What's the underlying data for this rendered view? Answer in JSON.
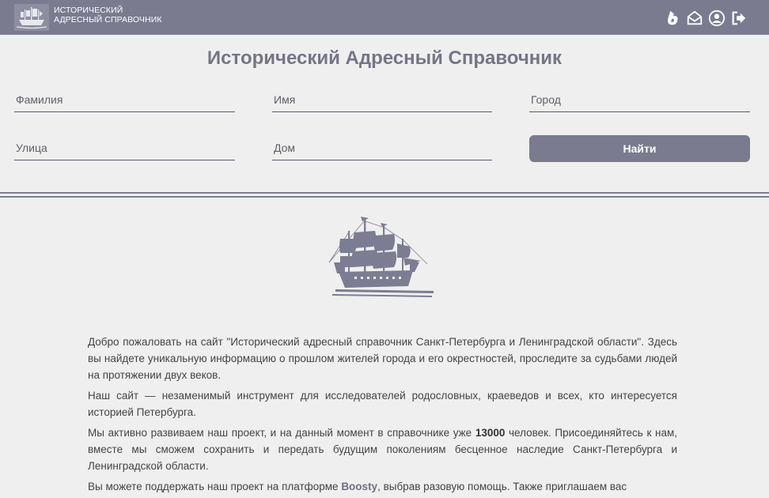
{
  "header": {
    "brand_line1": "ИСТОРИЧЕСКИЙ",
    "brand_line2": "АДРЕСНЫЙ СПРАВОЧНИК",
    "icons": [
      "boosty-icon",
      "mail-icon",
      "user-icon",
      "logout-icon"
    ]
  },
  "page_title": "Исторический Адресный Справочник",
  "search": {
    "surname_placeholder": "Фамилия",
    "name_placeholder": "Имя",
    "city_placeholder": "Город",
    "street_placeholder": "Улица",
    "house_placeholder": "Дом",
    "button_label": "Найти"
  },
  "content": {
    "p1": "Добро пожаловать на сайт \"Исторический адресный справочник Санкт-Петербурга и Ленинградской области\". Здесь вы найдете уникальную информацию о прошлом жителей города и его окрестностей, проследите за судьбами людей на протяжении двух веков.",
    "p2": "Наш сайт — незаменимый инструмент для исследователей родословных, краеведов и всех, кто интересуется историей Петербурга.",
    "p3_a": "Мы активно развиваем наш проект, и на данный момент в справочнике уже ",
    "p3_count": "13000",
    "p3_b": " человек. Присоединяйтесь к нам, вместе мы сможем сохранить и передать будущим поколениям бесценное наследие Санкт-Петербурга и Ленинградской области.",
    "p4_a": "Вы можете поддержать наш проект на платформе ",
    "p4_link": "Boosty",
    "p4_b": ", выбрав разовую помощь. Также приглашаем вас"
  },
  "colors": {
    "header_bg": "#7a7b8f",
    "page_bg": "#efefef",
    "title": "#757587",
    "accent": "#6e6f86"
  }
}
